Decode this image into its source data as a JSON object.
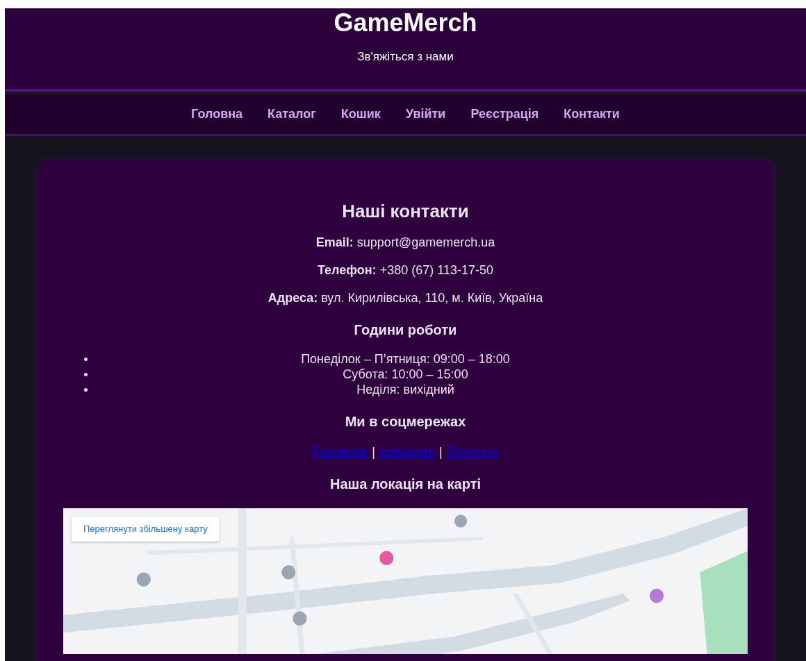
{
  "header": {
    "title": "GameMerch",
    "subtitle": "Зв'яжіться з нами"
  },
  "nav": [
    {
      "label": "Головна"
    },
    {
      "label": "Каталог"
    },
    {
      "label": "Кошик"
    },
    {
      "label": "Увійти"
    },
    {
      "label": "Реєстрація"
    },
    {
      "label": "Контакти"
    }
  ],
  "contacts": {
    "title": "Наші контакти",
    "lines": [
      "**Email:** support@gamemerch.ua",
      "**Телефон:** +380 (67) 113-17-50",
      "**Адреса:** вул. Кирилівська, 110, м. Київ, Україна"
    ],
    "hours_title": "Години роботи",
    "hours": [
      "Понеділок – П’ятниця: 09:00 – 18:00",
      "Субота: 10:00 – 15:00",
      "Неділя: вихідний"
    ],
    "social_title": "Ми в соцмережах",
    "social_links": [
      "Facebook",
      "Instagram",
      "Telegram"
    ],
    "separator": "|",
    "map_title": "Наша локація на карті",
    "map": {
      "kind": "picture",
      "button": "Переглянути збільшену карту"
    }
  }
}
